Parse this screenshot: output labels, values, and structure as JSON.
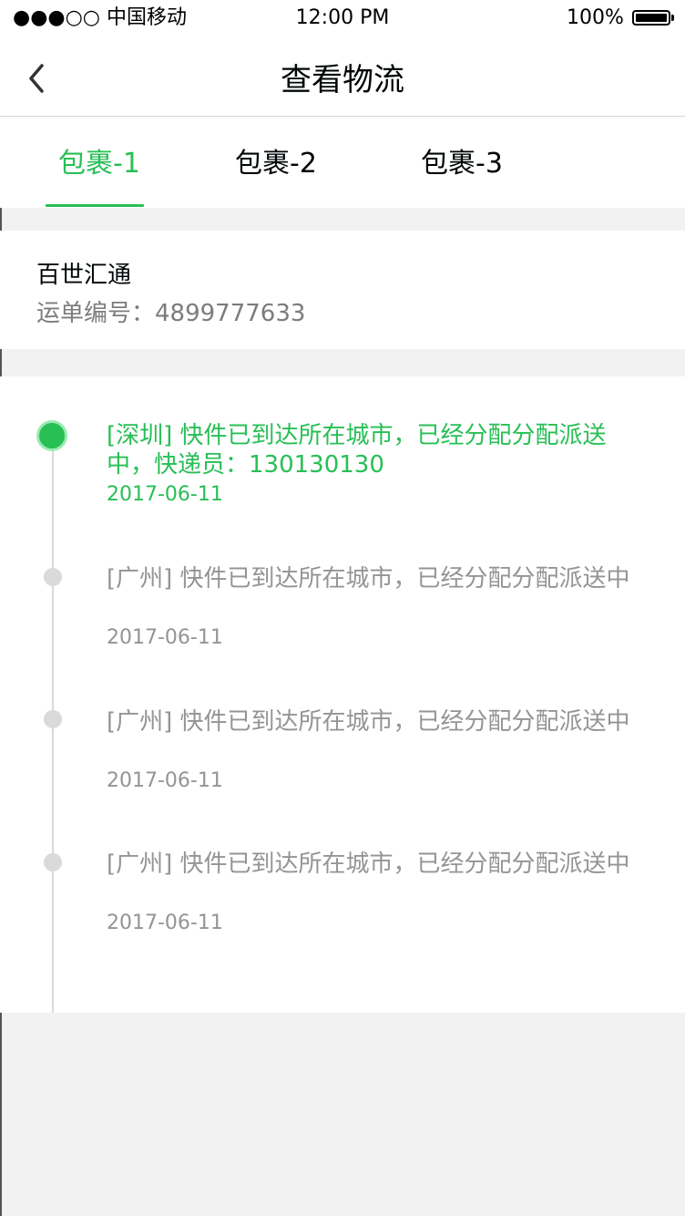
{
  "status_bar": {
    "carrier": "●●●○○ 中国移动",
    "time": "12:00 PM",
    "battery": "100%"
  },
  "nav": {
    "title": "查看物流",
    "back_icon": "chevron-left-icon"
  },
  "tabs": [
    {
      "label": "包裹-1",
      "active": true
    },
    {
      "label": "包裹-2",
      "active": false
    },
    {
      "label": "包裹-3",
      "active": false
    }
  ],
  "courier": {
    "name": "百世汇通",
    "tracking_label": "运单编号：4899777633"
  },
  "events": [
    {
      "text": "[深圳] 快件已到达所在城市，已经分配分配派送中，快递员：130130130",
      "date": "2017-06-11",
      "active": true
    },
    {
      "text": "[广州] 快件已到达所在城市，已经分配分配派送中",
      "date": "2017-06-11",
      "active": false
    },
    {
      "text": "[广州] 快件已到达所在城市，已经分配分配派送中",
      "date": "2017-06-11",
      "active": false
    },
    {
      "text": "[广州] 快件已到达所在城市，已经分配分配派送中",
      "date": "2017-06-11",
      "active": false
    }
  ],
  "colors": {
    "accent": "#28bf55",
    "accent_stroke": "#9aebb2",
    "text_primary": "#000607",
    "text_secondary": "#7c7c7c",
    "text_muted": "#949494"
  }
}
